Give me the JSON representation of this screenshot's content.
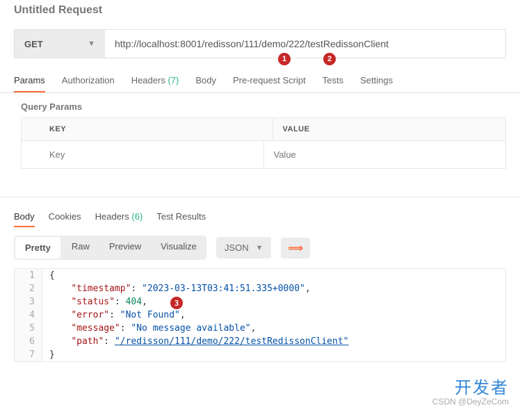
{
  "title": "Untitled Request",
  "method": "GET",
  "url": "http://localhost:8001/redisson/111/demo/222/testRedissonClient",
  "request_tabs": {
    "params": "Params",
    "auth": "Authorization",
    "headers": "Headers",
    "headers_count": "(7)",
    "body": "Body",
    "prereq": "Pre-request Script",
    "tests": "Tests",
    "settings": "Settings"
  },
  "query_params": {
    "title": "Query Params",
    "header_key": "KEY",
    "header_value": "VALUE",
    "placeholder_key": "Key",
    "placeholder_value": "Value"
  },
  "response_tabs": {
    "body": "Body",
    "cookies": "Cookies",
    "headers": "Headers",
    "headers_count": "(6)",
    "test_results": "Test Results"
  },
  "view": {
    "pretty": "Pretty",
    "raw": "Raw",
    "preview": "Preview",
    "visualize": "Visualize",
    "format": "JSON"
  },
  "response_body": {
    "timestamp": "2023-03-13T03:41:51.335+0000",
    "status": 404,
    "error": "Not Found",
    "message": "No message available",
    "path": "/redisson/111/demo/222/testRedissonClient"
  },
  "annotations": {
    "a1": "1",
    "a2": "2",
    "a3": "3"
  },
  "watermark": {
    "line1": "开发者",
    "line2": "CSDN @DeyZeCom"
  }
}
